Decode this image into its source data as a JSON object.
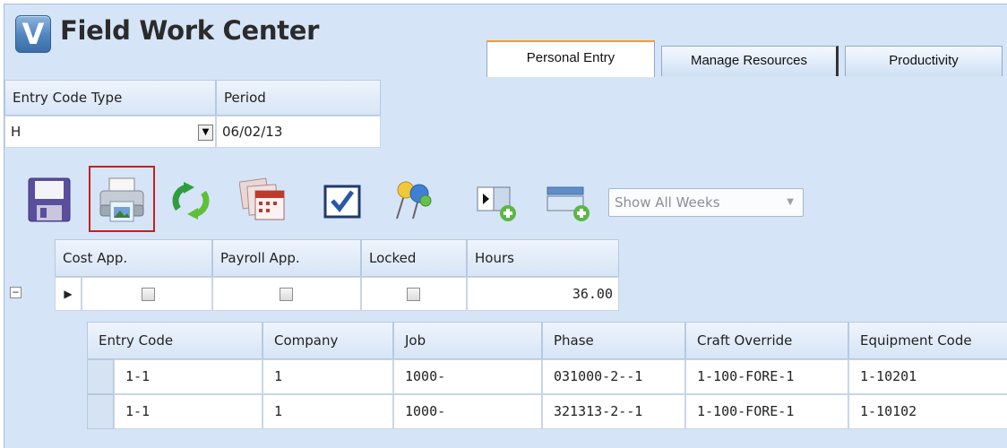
{
  "app": {
    "logo_letter": "V",
    "title": "Field Work Center"
  },
  "tabs": [
    {
      "label": "Personal Entry",
      "active": true
    },
    {
      "label": "Manage Resources",
      "active": false
    },
    {
      "label": "Productivity",
      "active": false
    }
  ],
  "filters": {
    "entry_code_type": {
      "label": "Entry Code Type",
      "value": "H"
    },
    "period": {
      "label": "Period",
      "value": "06/02/13"
    }
  },
  "toolbar": {
    "icons": [
      "save-icon",
      "print-icon",
      "refresh-icon",
      "calendar-icon",
      "checkbox-approve-icon",
      "pushpin-icon",
      "add-column-icon",
      "add-row-icon"
    ],
    "selected_icon": "print-icon",
    "week_filter": {
      "value": "Show All Weeks"
    }
  },
  "summary_grid": {
    "columns": [
      "Cost App.",
      "Payroll App.",
      "Locked",
      "Hours"
    ],
    "row": {
      "cost_app": false,
      "payroll_app": false,
      "locked": false,
      "hours": "36.00"
    }
  },
  "detail_grid": {
    "columns": [
      "Entry Code",
      "Company",
      "Job",
      "Phase",
      "Craft Override",
      "Equipment Code"
    ],
    "rows": [
      [
        "1-1",
        "1",
        "1000-",
        "031000-2--1",
        "1-100-FORE-1",
        "1-10201"
      ],
      [
        "1-1",
        "1",
        "1000-",
        "321313-2--1",
        "1-100-FORE-1",
        "1-10102"
      ]
    ]
  },
  "colors": {
    "accent_tab": "#f39b2f",
    "selection_outline": "#c8201e",
    "background": "#d6e4f7"
  }
}
